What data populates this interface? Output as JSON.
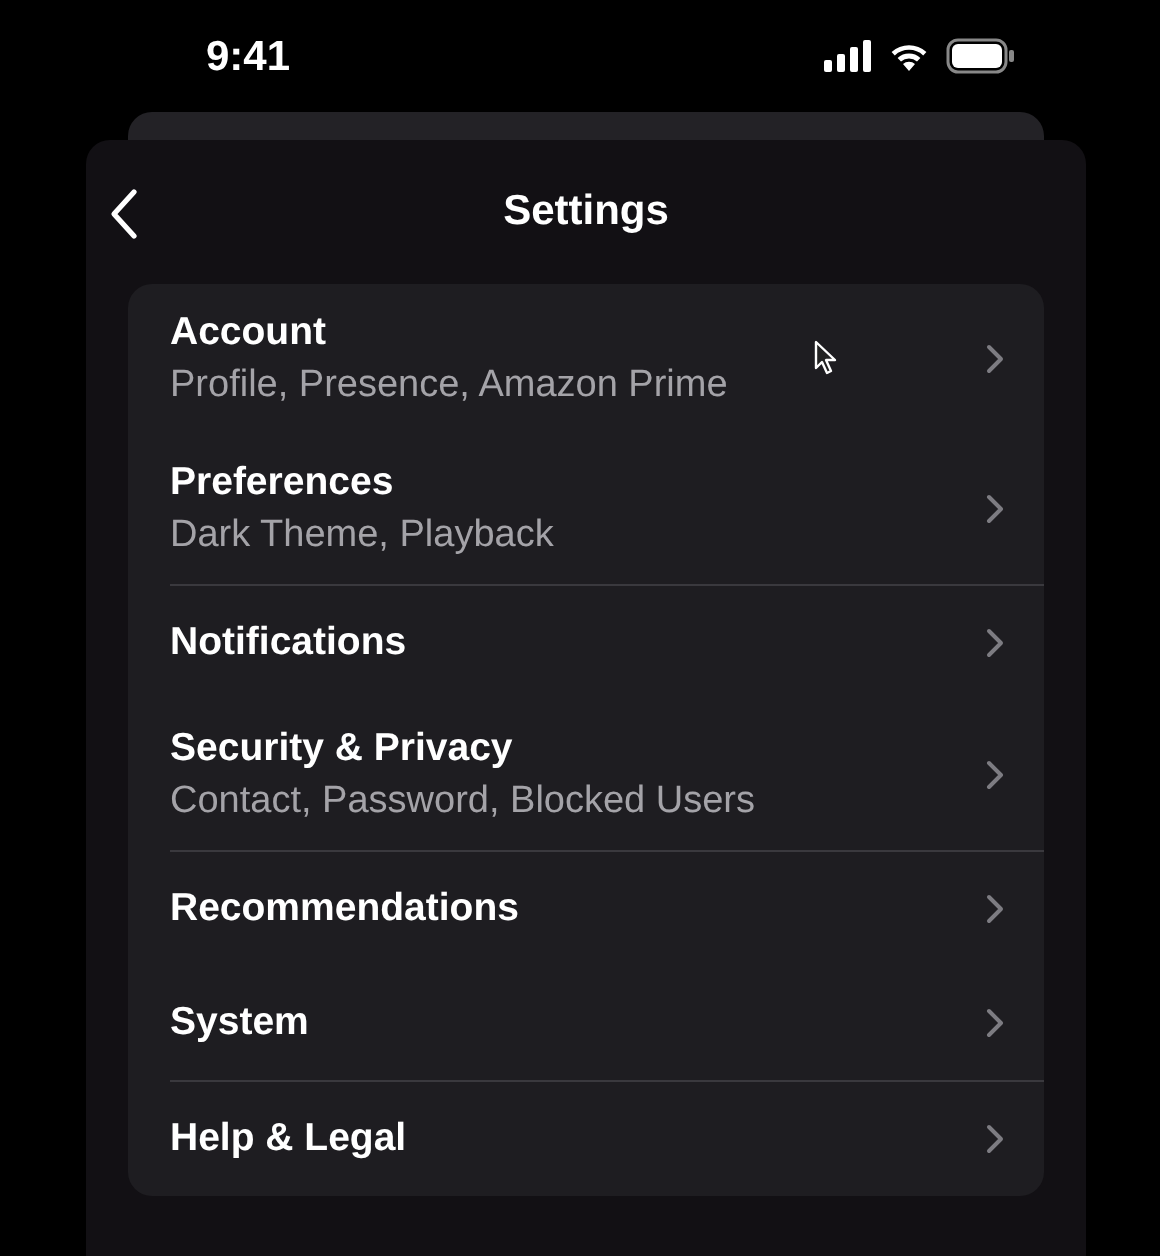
{
  "status_bar": {
    "time": "9:41"
  },
  "header": {
    "title": "Settings"
  },
  "items": [
    {
      "title": "Account",
      "subtitle": "Profile, Presence, Amazon Prime",
      "divider_below": false
    },
    {
      "title": "Preferences",
      "subtitle": "Dark Theme, Playback",
      "divider_below": true
    },
    {
      "title": "Notifications",
      "divider_below": false
    },
    {
      "title": "Security & Privacy",
      "subtitle": "Contact, Password, Blocked Users",
      "divider_below": true
    },
    {
      "title": "Recommendations",
      "divider_below": false
    },
    {
      "title": "System",
      "divider_below": true
    },
    {
      "title": "Help & Legal",
      "divider_below": false
    }
  ]
}
